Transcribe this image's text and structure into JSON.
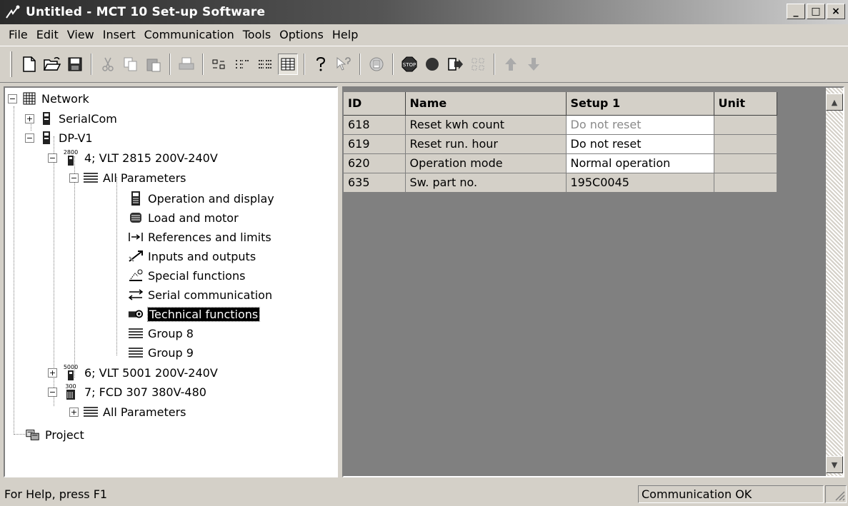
{
  "window": {
    "title": "Untitled - MCT 10 Set-up Software",
    "minimize": "_",
    "maximize": "□",
    "close": "×"
  },
  "menu": [
    "File",
    "Edit",
    "View",
    "Insert",
    "Communication",
    "Tools",
    "Options",
    "Help"
  ],
  "toolbar": {
    "icons": [
      "new-icon",
      "open-icon",
      "save-icon",
      "cut-icon",
      "copy-icon",
      "paste-icon",
      "print-icon",
      "large-icons-icon",
      "small-icons-icon",
      "list-icon",
      "details-icon",
      "help-icon",
      "context-help-icon",
      "connect-icon",
      "stop-icon",
      "record-icon",
      "download-icon",
      "upload-icon",
      "up-arrow-icon",
      "down-arrow-icon"
    ]
  },
  "tree": {
    "network": "Network",
    "serialcom": "SerialCom",
    "dpv1": "DP-V1",
    "device1": "4; VLT 2815 200V-240V",
    "device1_badge": "2800",
    "all_parameters": "All Parameters",
    "groups": [
      "Operation and display",
      "Load and motor",
      "References and limits",
      "Inputs and outputs",
      "Special functions",
      "Serial communication",
      "Technical functions",
      "Group 8",
      "Group 9"
    ],
    "device2": "6; VLT 5001 200V-240V",
    "device2_badge": "5000",
    "device3": "7; FCD 307 380V-480",
    "device3_badge": "300",
    "all_parameters_2": "All Parameters",
    "project": "Project"
  },
  "grid": {
    "columns": [
      "ID",
      "Name",
      "Setup 1",
      "Unit"
    ],
    "rows": [
      {
        "id": "618",
        "name": "Reset kwh count",
        "setup1": "Do not reset",
        "unit": ""
      },
      {
        "id": "619",
        "name": "Reset run. hour",
        "setup1": "Do not reset",
        "unit": ""
      },
      {
        "id": "620",
        "name": "Operation mode",
        "setup1": "Normal operation",
        "unit": ""
      },
      {
        "id": "635",
        "name": "Sw. part no.",
        "setup1": "195C0045",
        "unit": ""
      }
    ]
  },
  "status": {
    "help": "For Help, press F1",
    "connection": "Communication OK"
  }
}
